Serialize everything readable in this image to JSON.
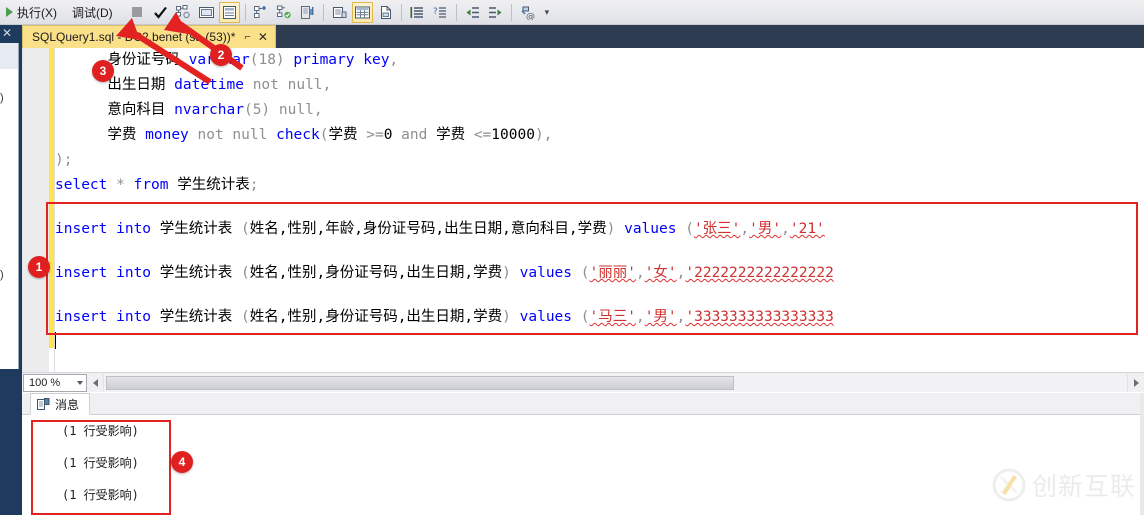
{
  "toolbar": {
    "run_label": "执行(X)",
    "debug_label": "调试(D)",
    "play_icon": "play-icon",
    "stop_icon": "stop-icon",
    "check_icon": "check-mark-icon",
    "parse_icon": "parse-query-icon",
    "display_icon": "display-estimated-plan-icon",
    "results_grid_icon": "results-to-grid-icon",
    "include_plan_icon": "include-actual-plan-icon",
    "live_stats_icon": "live-query-stats-icon",
    "client_stats_icon": "client-statistics-icon",
    "results_text_icon": "results-to-text-icon",
    "results_file_icon": "results-to-file-icon",
    "results_grid2_icon": "results-grid-icon",
    "comment_icon": "comment-lines-icon",
    "uncomment_icon": "uncomment-lines-icon",
    "decrease_indent_icon": "decrease-indent-icon",
    "increase_indent_icon": "increase-indent-icon",
    "specify_values_icon": "specify-values-template-icon",
    "overflow_label": "▾"
  },
  "tab": {
    "title": "SQLQuery1.sql - DC2.benet (sa (53))*",
    "pin_icon": "pin-icon",
    "close_icon": "close-icon"
  },
  "editor": {
    "zoom_level": "100 %",
    "lines": [
      {
        "id": "line-identity-card",
        "tokens": [
          {
            "t": "      ",
            "c": "id"
          },
          {
            "t": "身份证号码",
            "c": "id"
          },
          {
            "t": " ",
            "c": "id"
          },
          {
            "t": "varchar",
            "c": "kw"
          },
          {
            "t": "(18) ",
            "c": "kw2"
          },
          {
            "t": "primary key",
            "c": "kw"
          },
          {
            "t": ",",
            "c": "kw2"
          }
        ]
      },
      {
        "id": "line-birthdate",
        "tokens": [
          {
            "t": "      ",
            "c": "id"
          },
          {
            "t": "出生日期",
            "c": "id"
          },
          {
            "t": " ",
            "c": "id"
          },
          {
            "t": "datetime",
            "c": "kw"
          },
          {
            "t": " ",
            "c": "id"
          },
          {
            "t": "not null",
            "c": "kw2"
          },
          {
            "t": ",",
            "c": "kw2"
          }
        ]
      },
      {
        "id": "line-subject",
        "tokens": [
          {
            "t": "      ",
            "c": "id"
          },
          {
            "t": "意向科目",
            "c": "id"
          },
          {
            "t": " ",
            "c": "id"
          },
          {
            "t": "nvarchar",
            "c": "kw"
          },
          {
            "t": "(5) ",
            "c": "kw2"
          },
          {
            "t": "null",
            "c": "kw2"
          },
          {
            "t": ",",
            "c": "kw2"
          }
        ]
      },
      {
        "id": "line-tuition",
        "tokens": [
          {
            "t": "      ",
            "c": "id"
          },
          {
            "t": "学费",
            "c": "id"
          },
          {
            "t": " ",
            "c": "id"
          },
          {
            "t": "money",
            "c": "kw"
          },
          {
            "t": " ",
            "c": "id"
          },
          {
            "t": "not null",
            "c": "kw2"
          },
          {
            "t": " ",
            "c": "id"
          },
          {
            "t": "check",
            "c": "kw"
          },
          {
            "t": "(",
            "c": "kw2"
          },
          {
            "t": "学费",
            "c": "id"
          },
          {
            "t": " ",
            "c": "id"
          },
          {
            "t": ">=",
            "c": "kw2"
          },
          {
            "t": "0",
            "c": "num"
          },
          {
            "t": " ",
            "c": "id"
          },
          {
            "t": "and",
            "c": "kw2"
          },
          {
            "t": " ",
            "c": "id"
          },
          {
            "t": "学费",
            "c": "id"
          },
          {
            "t": " ",
            "c": "id"
          },
          {
            "t": "<=",
            "c": "kw2"
          },
          {
            "t": "10000",
            "c": "num"
          },
          {
            "t": "),",
            "c": "kw2"
          }
        ]
      },
      {
        "id": "line-close-paren",
        "tokens": [
          {
            "t": ");",
            "c": "kw2"
          }
        ]
      },
      {
        "id": "line-select",
        "tokens": [
          {
            "t": "select",
            "c": "kw"
          },
          {
            "t": " ",
            "c": "id"
          },
          {
            "t": "*",
            "c": "kw2"
          },
          {
            "t": " ",
            "c": "id"
          },
          {
            "t": "from",
            "c": "kw"
          },
          {
            "t": " ",
            "c": "id"
          },
          {
            "t": "学生统计表",
            "c": "id"
          },
          {
            "t": ";",
            "c": "kw2"
          }
        ]
      },
      {
        "id": "line-insert-1",
        "tokens": [
          {
            "t": "insert into",
            "c": "kw"
          },
          {
            "t": " ",
            "c": "id"
          },
          {
            "t": "学生统计表",
            "c": "id"
          },
          {
            "t": " (",
            "c": "kw2"
          },
          {
            "t": "姓名,性别,年龄,身份证号码,出生日期,意向科目,学费",
            "c": "id"
          },
          {
            "t": ") ",
            "c": "kw2"
          },
          {
            "t": "values",
            "c": "kw"
          },
          {
            "t": " (",
            "c": "kw2"
          },
          {
            "t": "'张三'",
            "c": "str sq"
          },
          {
            "t": ",",
            "c": "kw2"
          },
          {
            "t": "'男'",
            "c": "str sq"
          },
          {
            "t": ",",
            "c": "kw2"
          },
          {
            "t": "'21'",
            "c": "str sq"
          }
        ]
      },
      {
        "id": "line-insert-2",
        "tokens": [
          {
            "t": "insert into",
            "c": "kw"
          },
          {
            "t": " ",
            "c": "id"
          },
          {
            "t": "学生统计表",
            "c": "id"
          },
          {
            "t": " (",
            "c": "kw2"
          },
          {
            "t": "姓名,性别,身份证号码,出生日期,学费",
            "c": "id"
          },
          {
            "t": ") ",
            "c": "kw2"
          },
          {
            "t": "values",
            "c": "kw"
          },
          {
            "t": " (",
            "c": "kw2"
          },
          {
            "t": "'丽丽'",
            "c": "str sq"
          },
          {
            "t": ",",
            "c": "kw2"
          },
          {
            "t": "'女'",
            "c": "str sq"
          },
          {
            "t": ",",
            "c": "kw2"
          },
          {
            "t": "'2222222222222222",
            "c": "str sq"
          }
        ]
      },
      {
        "id": "line-insert-3",
        "tokens": [
          {
            "t": "insert into",
            "c": "kw"
          },
          {
            "t": " ",
            "c": "id"
          },
          {
            "t": "学生统计表",
            "c": "id"
          },
          {
            "t": " (",
            "c": "kw2"
          },
          {
            "t": "姓名,性别,身份证号码,出生日期,学费",
            "c": "id"
          },
          {
            "t": ") ",
            "c": "kw2"
          },
          {
            "t": "values",
            "c": "kw"
          },
          {
            "t": " (",
            "c": "kw2"
          },
          {
            "t": "'马三'",
            "c": "str sq"
          },
          {
            "t": ",",
            "c": "kw2"
          },
          {
            "t": "'男'",
            "c": "str sq"
          },
          {
            "t": ",",
            "c": "kw2"
          },
          {
            "t": "'3333333333333333",
            "c": "str sq"
          }
        ]
      }
    ]
  },
  "results": {
    "tab_label": "消息",
    "tab_icon": "messages-icon",
    "messages": [
      "(1 行受影响)",
      "(1 行受影响)",
      "(1 行受影响)"
    ]
  },
  "annotations": {
    "badge1": "1",
    "badge2": "2",
    "badge3": "3",
    "badge4": "4",
    "accent_color": "#e32222"
  },
  "watermark": {
    "text": "创新互联",
    "logo_icon": "cx-logo-icon"
  }
}
